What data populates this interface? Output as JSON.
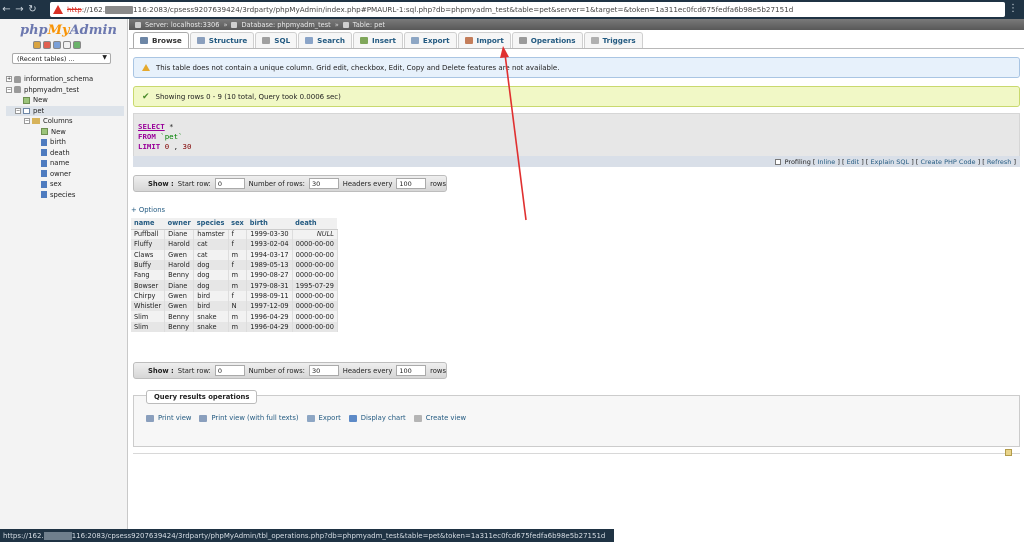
{
  "browser": {
    "url_scheme": "http",
    "url_host_prefix": "://162.",
    "url_rest": "116:2083/cpsess9207639424/3rdparty/phpMyAdmin/index.php#PMAURL-1:sql.php?db=phpmyadm_test&table=pet&server=1&target=&token=1a311ec0fcd675fedfa6b98e5b27151d",
    "status_prefix": "https://162.",
    "status_rest": "116:2083/cpsess9207639424/3rdparty/phpMyAdmin/tbl_operations.php?db=phpmyadm_test&table=pet&token=1a311ec0fcd675fedfa6b98e5b27151d"
  },
  "logo": {
    "php": "php",
    "my": "My",
    "admin": "Admin"
  },
  "recent": "(Recent tables) ...",
  "tree": [
    {
      "label": "information_schema",
      "depth": 0,
      "type": "db",
      "toggle": "+"
    },
    {
      "label": "phpmyadm_test",
      "depth": 0,
      "type": "db",
      "toggle": "−"
    },
    {
      "label": "New",
      "depth": 1,
      "type": "new"
    },
    {
      "label": "pet",
      "depth": 1,
      "type": "table",
      "toggle": "−",
      "selected": true
    },
    {
      "label": "Columns",
      "depth": 2,
      "type": "folder",
      "toggle": "−"
    },
    {
      "label": "New",
      "depth": 3,
      "type": "new"
    },
    {
      "label": "birth",
      "depth": 3,
      "type": "col"
    },
    {
      "label": "death",
      "depth": 3,
      "type": "col"
    },
    {
      "label": "name",
      "depth": 3,
      "type": "col"
    },
    {
      "label": "owner",
      "depth": 3,
      "type": "col"
    },
    {
      "label": "sex",
      "depth": 3,
      "type": "col"
    },
    {
      "label": "species",
      "depth": 3,
      "type": "col"
    }
  ],
  "breadcrumb": {
    "server": "Server: localhost:3306",
    "database": "Database: phpmyadm_test",
    "table": "Table: pet"
  },
  "tabs": [
    {
      "label": "Browse",
      "icon": "browse-icon",
      "color": "#6d86a6",
      "active": true
    },
    {
      "label": "Structure",
      "icon": "structure-icon",
      "color": "#8a9fbd"
    },
    {
      "label": "SQL",
      "icon": "sql-icon",
      "color": "#a0a0a0"
    },
    {
      "label": "Search",
      "icon": "search-icon",
      "color": "#8aa4c8"
    },
    {
      "label": "Insert",
      "icon": "insert-icon",
      "color": "#7fa65a"
    },
    {
      "label": "Export",
      "icon": "export-icon",
      "color": "#8da6c4"
    },
    {
      "label": "Import",
      "icon": "import-icon",
      "color": "#c47d5a"
    },
    {
      "label": "Operations",
      "icon": "wrench-icon",
      "color": "#9a9a9a"
    },
    {
      "label": "Triggers",
      "icon": "triggers-icon",
      "color": "#b0b0b0"
    }
  ],
  "warning": "This table does not contain a unique column. Grid edit, checkbox, Edit, Copy and Delete features are not available.",
  "success": "Showing rows 0 - 9 (10 total, Query took 0.0006 sec)",
  "sql": {
    "select": "SELECT",
    "star": "*",
    "from": "FROM",
    "table": "`pet`",
    "limit": "LIMIT",
    "offset": "0",
    "comma": ",",
    "count": "30"
  },
  "profiling": {
    "label": "Profiling",
    "links": [
      "Inline",
      "Edit",
      "Explain SQL",
      "Create PHP Code",
      "Refresh"
    ]
  },
  "nav": {
    "show": "Show :",
    "start_label": "Start row:",
    "start_value": "0",
    "rows_label": "Number of rows:",
    "rows_value": "30",
    "headers_label": "Headers every",
    "headers_value": "100",
    "rows_suffix": "rows"
  },
  "options_link": "+ Options",
  "table": {
    "headers": [
      "name",
      "owner",
      "species",
      "sex",
      "birth",
      "death"
    ],
    "rows": [
      [
        "Puffball",
        "Diane",
        "hamster",
        "f",
        "1999-03-30",
        "NULL"
      ],
      [
        "Fluffy",
        "Harold",
        "cat",
        "f",
        "1993-02-04",
        "0000-00-00"
      ],
      [
        "Claws",
        "Gwen",
        "cat",
        "m",
        "1994-03-17",
        "0000-00-00"
      ],
      [
        "Buffy",
        "Harold",
        "dog",
        "f",
        "1989-05-13",
        "0000-00-00"
      ],
      [
        "Fang",
        "Benny",
        "dog",
        "m",
        "1990-08-27",
        "0000-00-00"
      ],
      [
        "Bowser",
        "Diane",
        "dog",
        "m",
        "1979-08-31",
        "1995-07-29"
      ],
      [
        "Chirpy",
        "Gwen",
        "bird",
        "f",
        "1998-09-11",
        "0000-00-00"
      ],
      [
        "Whistler",
        "Gwen",
        "bird",
        "N",
        "1997-12-09",
        "0000-00-00"
      ],
      [
        "Slim",
        "Benny",
        "snake",
        "m",
        "1996-04-29",
        "0000-00-00"
      ],
      [
        "Slim",
        "Benny",
        "snake",
        "m",
        "1996-04-29",
        "0000-00-00"
      ]
    ]
  },
  "query_ops": {
    "title": "Query results operations",
    "links": [
      {
        "label": "Print view",
        "icon": "print-icon",
        "color": "#8a9fbd"
      },
      {
        "label": "Print view (with full texts)",
        "icon": "print-full-icon",
        "color": "#8a9fbd"
      },
      {
        "label": "Export",
        "icon": "export-icon",
        "color": "#8da6c4"
      },
      {
        "label": "Display chart",
        "icon": "chart-icon",
        "color": "#5d8ac7"
      },
      {
        "label": "Create view",
        "icon": "view-icon",
        "color": "#b5b5b5"
      }
    ]
  },
  "colors": {
    "link": "#235a81",
    "annotation_arrow": "#e03030"
  }
}
